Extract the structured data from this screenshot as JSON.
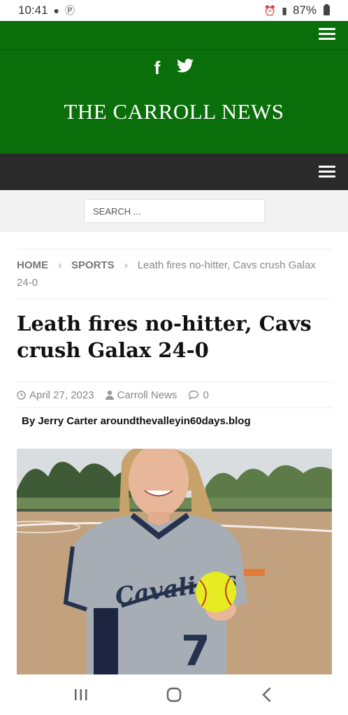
{
  "status_bar": {
    "time": "10:41",
    "battery": "87%"
  },
  "site": {
    "title": "THE CARROLL NEWS",
    "brand_color": "#0a6e0a",
    "social": [
      "facebook-icon",
      "twitter-icon"
    ]
  },
  "search": {
    "placeholder": "SEARCH ..."
  },
  "breadcrumb": {
    "home": "HOME",
    "section": "SPORTS",
    "current": "Leath fires no-hitter, Cavs crush Galax 24-0"
  },
  "article": {
    "title": "Leath fires no-hitter, Cavs crush Galax 24-0",
    "date": "April 27, 2023",
    "author": "Carroll News",
    "comments": "0",
    "byline": "By Jerry Carter aroundthevalleyin60days.blog",
    "photo_jersey_text": "Cavaliers",
    "photo_jersey_number": "7"
  }
}
